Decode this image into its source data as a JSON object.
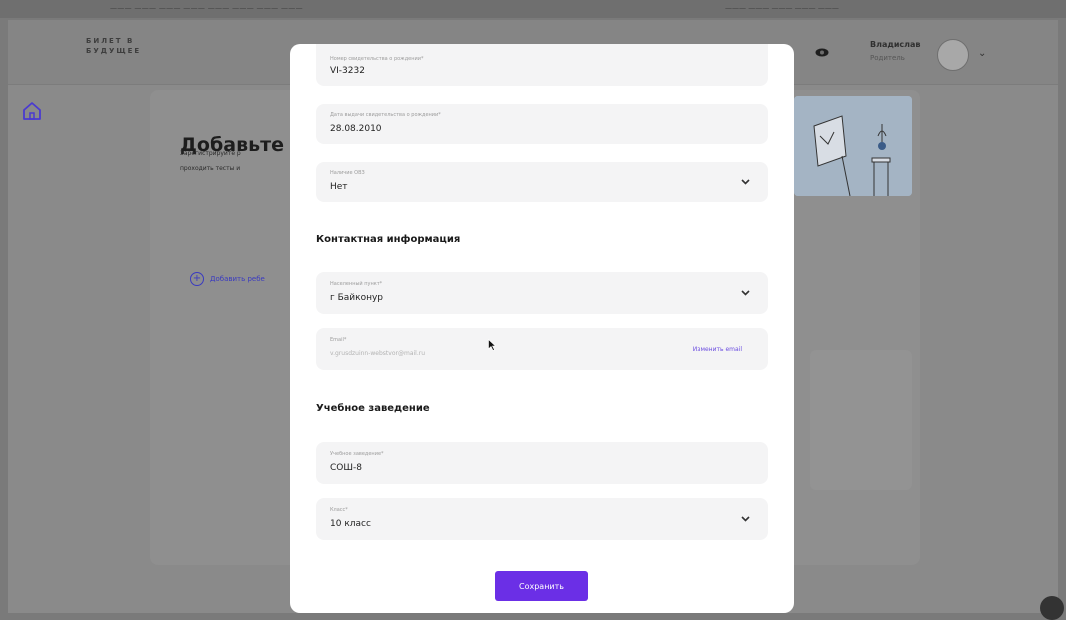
{
  "top_strip": {
    "left_text": "——— ——— ——— ——— ——— ——— ——— ———",
    "right_text": "——— ——— ——— ——— ———"
  },
  "header": {
    "logo": "БИЛЕТ В\nБУДУЩЕЕ",
    "user_name": "Владислав",
    "user_role": "Родитель"
  },
  "background": {
    "title": "Добавьте р",
    "subtitle_line1": "Зарегистрируйте р",
    "subtitle_line2": "проходить тесты и",
    "add_link": "Добавить ребе"
  },
  "modal": {
    "fields": [
      {
        "label": "Номер свидетельства о рождении*",
        "value": "VI-3232"
      },
      {
        "label": "Дата выдачи свидетельства о рождении*",
        "value": "28.08.2010"
      },
      {
        "label": "Наличие ОВЗ",
        "value": "Нет",
        "type": "select"
      }
    ],
    "contact_section_title": "Контактная информация",
    "contact_fields": [
      {
        "label": "Населенный пункт*",
        "value": "г Байконур",
        "type": "select"
      },
      {
        "label": "Email*",
        "value": "v.grusdzuinn-webstvor@mail.ru",
        "link": "Изменить email"
      }
    ],
    "education_section_title": "Учебное заведение",
    "education_fields": [
      {
        "label": "Учебное заведение*",
        "value": "СОШ-8"
      },
      {
        "label": "Класс*",
        "value": "10 класс",
        "type": "select"
      }
    ],
    "save_button": "Сохранить"
  },
  "colors": {
    "accent": "#6b2fe6",
    "link": "#6b4de0",
    "field_bg": "#f4f4f5",
    "overlay": "#7a7a7a"
  }
}
